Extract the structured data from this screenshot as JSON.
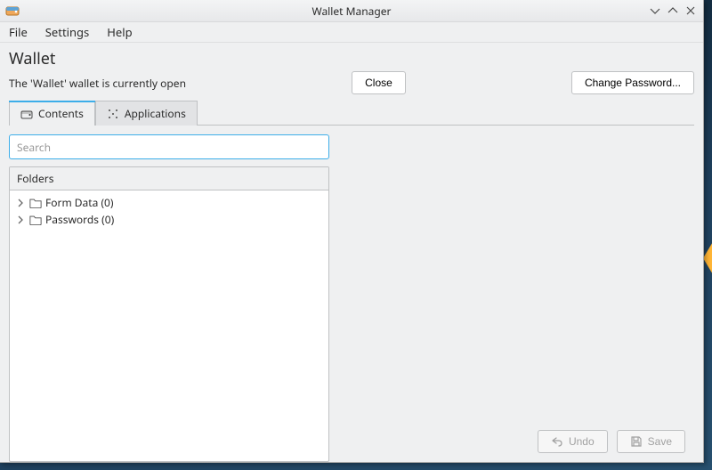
{
  "window_title": "Wallet Manager",
  "menubar": {
    "file": "File",
    "settings": "Settings",
    "help": "Help"
  },
  "header": {
    "wallet_name": "Wallet",
    "status_text": "The 'Wallet' wallet is currently open",
    "close_label": "Close",
    "change_password_label": "Change Password..."
  },
  "tabs": {
    "contents": "Contents",
    "applications": "Applications",
    "active": "contents"
  },
  "search": {
    "placeholder": "Search"
  },
  "folders": {
    "header": "Folders",
    "items": [
      {
        "label": "Form Data (0)"
      },
      {
        "label": "Passwords (0)"
      }
    ]
  },
  "footer": {
    "undo": "Undo",
    "save": "Save"
  }
}
